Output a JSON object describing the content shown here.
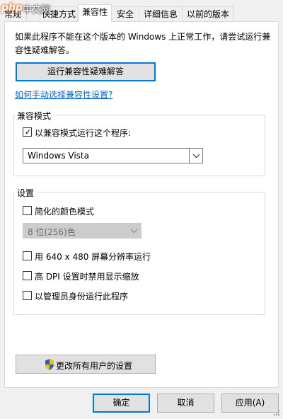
{
  "tabs": [
    {
      "label": "常规",
      "active": false
    },
    {
      "label": "快捷方式",
      "active": false
    },
    {
      "label": "兼容性",
      "active": true
    },
    {
      "label": "安全",
      "active": false
    },
    {
      "label": "详细信息",
      "active": false
    },
    {
      "label": "以前的版本",
      "active": false
    }
  ],
  "watermark": {
    "php": "php",
    "cn": "中文网"
  },
  "intro_text_1": "如果此程序不能在这个版本的 Windows 上正常工作，请尝试运行兼",
  "intro_text_2": "容性疑难解答。",
  "troubleshooter_button": "运行兼容性疑难解答",
  "manual_link": "如何手动选择兼容性设置?",
  "compat_mode": {
    "group_label": "兼容模式",
    "checkbox_label": "以兼容模式运行这个程序:",
    "checked": true,
    "selected_os": "Windows Vista"
  },
  "settings": {
    "group_label": "设置",
    "reduced_color_label": "简化的颜色模式",
    "color_option": "8 位(256)色",
    "res_label": "用 640 x 480 屏幕分辨率运行",
    "dpi_label": "高 DPI 设置时禁用显示缩放",
    "admin_label": "以管理员身份运行此程序"
  },
  "change_all_users_button": "更改所有用户的设置",
  "footer": {
    "ok": "确定",
    "cancel": "取消",
    "apply": "应用(A)"
  },
  "colors": {
    "accent": "#0078d7",
    "link": "#0066cc",
    "shield_blue": "#2a5ea8",
    "shield_yellow": "#f2c10d"
  }
}
